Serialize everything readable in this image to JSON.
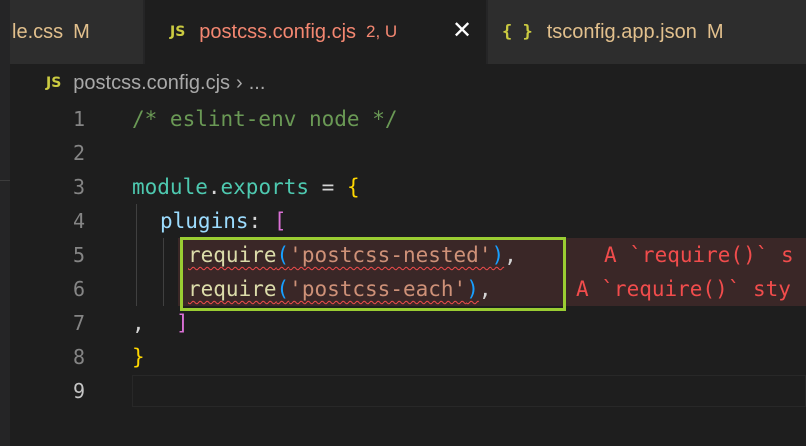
{
  "tabs": [
    {
      "name": "le.css",
      "status": "M",
      "kind": "css",
      "state": "modified"
    },
    {
      "name": "postcss.config.cjs",
      "status": "2, U",
      "kind": "js",
      "state": "error",
      "active": true
    },
    {
      "name": "tsconfig.app.json",
      "status": "M",
      "kind": "json",
      "state": "modified"
    }
  ],
  "icons": {
    "js_badge": "JS",
    "json_badge": "{ }",
    "close": "✕",
    "chevron": "›"
  },
  "breadcrumb": {
    "file": "postcss.config.cjs",
    "ellipsis": "..."
  },
  "editor": {
    "active_line": 9,
    "lines": [
      {
        "number": "1",
        "text": "/* eslint-env node */"
      },
      {
        "number": "2",
        "text": ""
      },
      {
        "number": "3",
        "text": "module.exports = {"
      },
      {
        "number": "4",
        "text": "  plugins: ["
      },
      {
        "number": "5",
        "text": "    require('postcss-nested'),",
        "error": "A `require()` s"
      },
      {
        "number": "6",
        "text": "    require('postcss-each'),",
        "error": "A `require()` sty"
      },
      {
        "number": "7",
        "text": ", ]"
      },
      {
        "number": "8",
        "text": "}"
      },
      {
        "number": "9",
        "text": ""
      }
    ]
  },
  "tokens": {
    "l1_comment": "/* eslint-env node */",
    "l3_module": "module",
    "l3_dot": ".",
    "l3_exports": "exports",
    "l3_eq": " = ",
    "l3_brace": "{",
    "l4_plugins": "plugins",
    "l4_colon": ": ",
    "l4_bracket": "[",
    "l5_require": "require",
    "l5_open": "(",
    "l5_string": "'postcss-nested'",
    "l5_close": ")",
    "l5_comma": ",",
    "l6_require": "require",
    "l6_open": "(",
    "l6_string": "'postcss-each'",
    "l6_close": ")",
    "l6_comma": ",",
    "l7_comma": ",",
    "l7_bracket": "]",
    "l8_brace": "}"
  },
  "colors": {
    "error": "#f14c4c",
    "highlight_box": "#9acd32",
    "modified": "#e2c08d"
  }
}
